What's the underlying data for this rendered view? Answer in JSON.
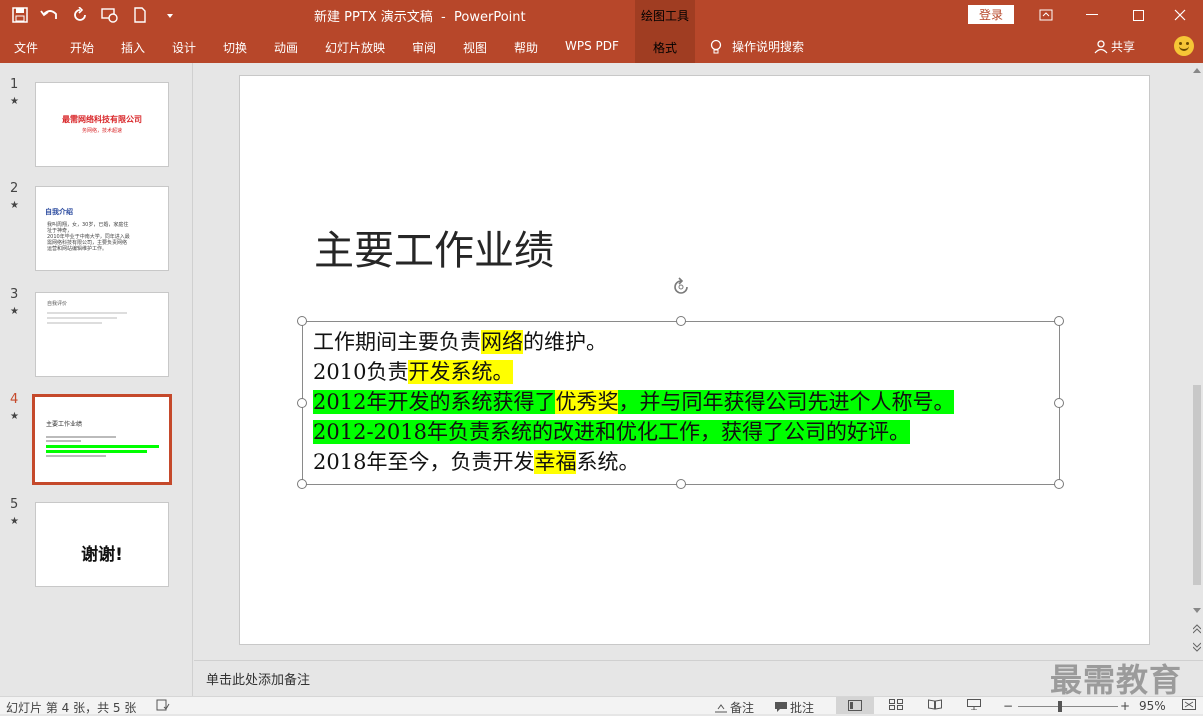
{
  "window": {
    "title": "新建 PPTX 演示文稿  -  PowerPoint",
    "context_tab": "绘图工具",
    "login": "登录"
  },
  "ribbon": {
    "tabs": [
      {
        "label": "文件"
      },
      {
        "label": "开始"
      },
      {
        "label": "插入"
      },
      {
        "label": "设计"
      },
      {
        "label": "切换"
      },
      {
        "label": "动画"
      },
      {
        "label": "幻灯片放映"
      },
      {
        "label": "审阅"
      },
      {
        "label": "视图"
      },
      {
        "label": "帮助"
      },
      {
        "label": "WPS PDF"
      },
      {
        "label": "格式"
      }
    ],
    "search": "操作说明搜索",
    "share": "共享"
  },
  "thumbnails": [
    {
      "num": "1",
      "title": "最需网络科技有限公司",
      "subtitle": "务网络，技术超速"
    },
    {
      "num": "2",
      "title": "自我介绍",
      "body": [
        "我叫周翔，女，30岁，已婚，家庭住",
        "址于神奇，",
        "2010年毕业于中南大学，同年进入最",
        "需网络科技有限公司，主要负责网络",
        "运营和网站编辑维护工作。"
      ]
    },
    {
      "num": "3",
      "title": "自我评价"
    },
    {
      "num": "4",
      "title": "主要工作业绩"
    },
    {
      "num": "5",
      "title": "谢谢!"
    }
  ],
  "slide": {
    "title": "主要工作业绩",
    "lines": [
      [
        {
          "t": "工作期间主要负责",
          "h": ""
        },
        {
          "t": "网络",
          "h": "y"
        },
        {
          "t": "的维护。",
          "h": ""
        }
      ],
      [
        {
          "t": "2010负责",
          "h": ""
        },
        {
          "t": "开发系统。",
          "h": "y"
        }
      ],
      [
        {
          "t": "2012年开发的系统获得了",
          "h": "g"
        },
        {
          "t": "优秀奖",
          "h": "y"
        },
        {
          "t": "，并与同年获得公司先进个人称号。",
          "h": "g"
        }
      ],
      [
        {
          "t": "2012-2018年负责系统的改进和优化工作，获得了公司的好评。",
          "h": "g"
        }
      ],
      [
        {
          "t": "2018年至今，负责开发",
          "h": ""
        },
        {
          "t": "幸福",
          "h": "y"
        },
        {
          "t": "系统。",
          "h": ""
        }
      ]
    ]
  },
  "notes": {
    "placeholder": "单击此处添加备注"
  },
  "watermark": "最需教育",
  "status": {
    "slide_info": "幻灯片 第 4 张，共 5 张",
    "notes_btn": "备注",
    "comments_btn": "批注",
    "zoom": "95%"
  },
  "colors": {
    "accent": "#b7472a",
    "highlight_yellow": "#ffff00",
    "highlight_green": "#00ff00"
  }
}
